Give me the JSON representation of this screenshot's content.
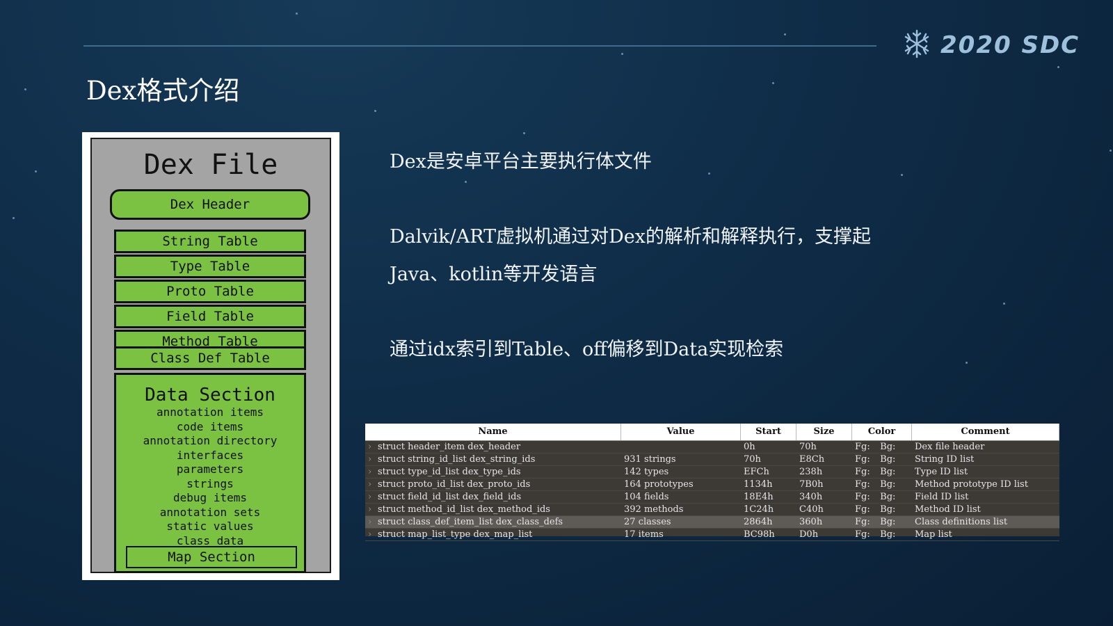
{
  "header": {
    "logo_text": "2020 SDC",
    "logo_icon": "snowflake-icon",
    "title": "Dex格式介绍"
  },
  "diagram": {
    "title": "Dex File",
    "header_box": "Dex Header",
    "tables": [
      "String Table",
      "Type Table",
      "Proto Table",
      "Field Table",
      "Method Table",
      "Class Def Table"
    ],
    "data_section": {
      "title": "Data Section",
      "items": [
        "annotation items",
        "code items",
        "annotation directory",
        "interfaces",
        "parameters",
        "strings",
        "debug items",
        "annotation sets",
        "static values",
        "class data"
      ]
    },
    "map_section": "Map Section"
  },
  "bullets": {
    "line1": "Dex是安卓平台主要执行体文件",
    "line2": "Dalvik/ART虚拟机通过对Dex的解析和解释执行，支撑起",
    "line3": "Java、kotlin等开发语言",
    "line4": "通过idx索引到Table、off偏移到Data实现检索"
  },
  "table": {
    "columns": [
      "Name",
      "Value",
      "Start",
      "Size",
      "Color",
      "Comment"
    ],
    "rows": [
      {
        "name": "struct header_item dex_header",
        "value": "",
        "start": "0h",
        "size": "70h",
        "fg": "Fg:",
        "bg": "Bg:",
        "comment": "Dex file header"
      },
      {
        "name": "struct string_id_list dex_string_ids",
        "value": "931 strings",
        "start": "70h",
        "size": "E8Ch",
        "fg": "Fg:",
        "bg": "Bg:",
        "comment": "String ID list"
      },
      {
        "name": "struct type_id_list dex_type_ids",
        "value": "142 types",
        "start": "EFCh",
        "size": "238h",
        "fg": "Fg:",
        "bg": "Bg:",
        "comment": "Type ID list"
      },
      {
        "name": "struct proto_id_list dex_proto_ids",
        "value": "164 prototypes",
        "start": "1134h",
        "size": "7B0h",
        "fg": "Fg:",
        "bg": "Bg:",
        "comment": "Method prototype ID list"
      },
      {
        "name": "struct field_id_list dex_field_ids",
        "value": "104 fields",
        "start": "18E4h",
        "size": "340h",
        "fg": "Fg:",
        "bg": "Bg:",
        "comment": "Field ID list"
      },
      {
        "name": "struct method_id_list dex_method_ids",
        "value": "392 methods",
        "start": "1C24h",
        "size": "C40h",
        "fg": "Fg:",
        "bg": "Bg:",
        "comment": "Method ID list"
      },
      {
        "name": "struct class_def_item_list dex_class_defs",
        "value": "27 classes",
        "start": "2864h",
        "size": "360h",
        "fg": "Fg:",
        "bg": "Bg:",
        "comment": "Class definitions list"
      },
      {
        "name": "struct map_list_type dex_map_list",
        "value": "17 items",
        "start": "BC98h",
        "size": "D0h",
        "fg": "Fg:",
        "bg": "Bg:",
        "comment": "Map list"
      }
    ]
  }
}
